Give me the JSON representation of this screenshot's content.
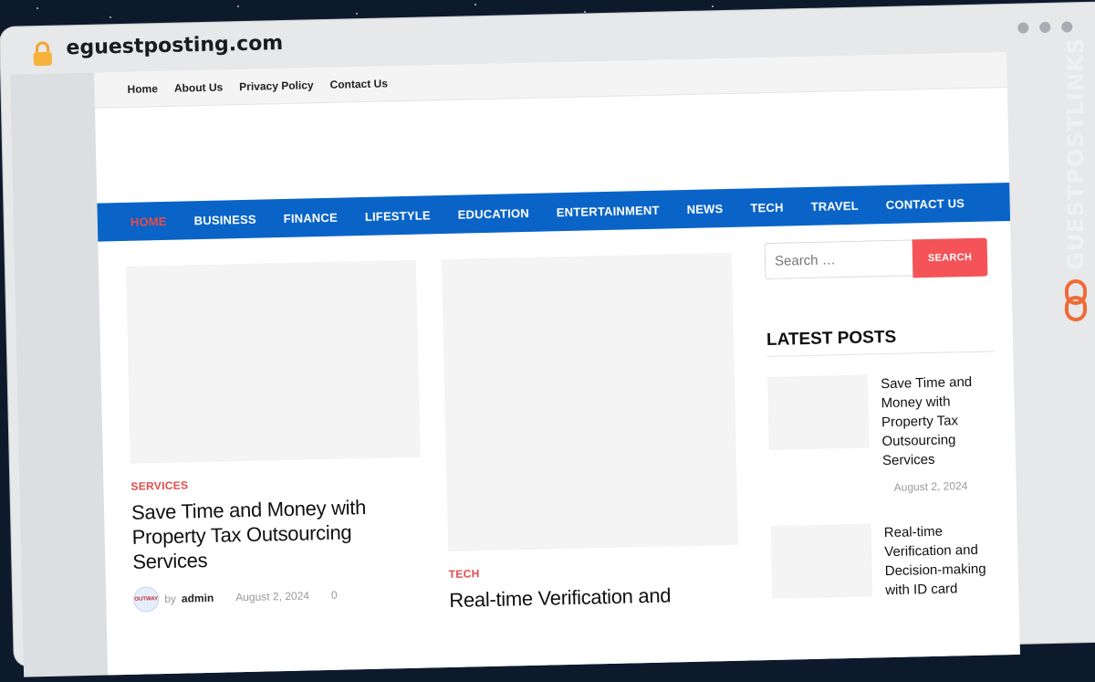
{
  "browser": {
    "domain": "eguestposting.com"
  },
  "topbar": {
    "items": [
      "Home",
      "About Us",
      "Privacy Policy",
      "Contact Us"
    ]
  },
  "mainnav": {
    "items": [
      "HOME",
      "BUSINESS",
      "FINANCE",
      "LIFESTYLE",
      "EDUCATION",
      "ENTERTAINMENT",
      "NEWS",
      "TECH",
      "TRAVEL",
      "CONTACT US"
    ],
    "active": "HOME"
  },
  "posts": [
    {
      "category": "SERVICES",
      "title": "Save Time and Money with Property Tax Outsourcing Services",
      "by": "by",
      "author": "admin",
      "date": "August 2, 2024",
      "comments": "0",
      "avatar_text": "OUTWAY"
    },
    {
      "category": "TECH",
      "title": "Real-time Verification and"
    }
  ],
  "sidebar": {
    "search_placeholder": "Search …",
    "search_button": "SEARCH",
    "widget_title": "LATEST POSTS",
    "latest": [
      {
        "title": "Save Time and Money with Property Tax Outsourcing Services",
        "date": "August 2, 2024"
      },
      {
        "title": "Real-time Verification and Decision-making with ID card"
      }
    ]
  },
  "brand": {
    "name": "GUESTPOSTLINKS"
  },
  "colors": {
    "nav_blue": "#0a64c7",
    "accent_red": "#e24a4a",
    "search_button": "#f45458",
    "brand_orange": "#f06a35"
  }
}
